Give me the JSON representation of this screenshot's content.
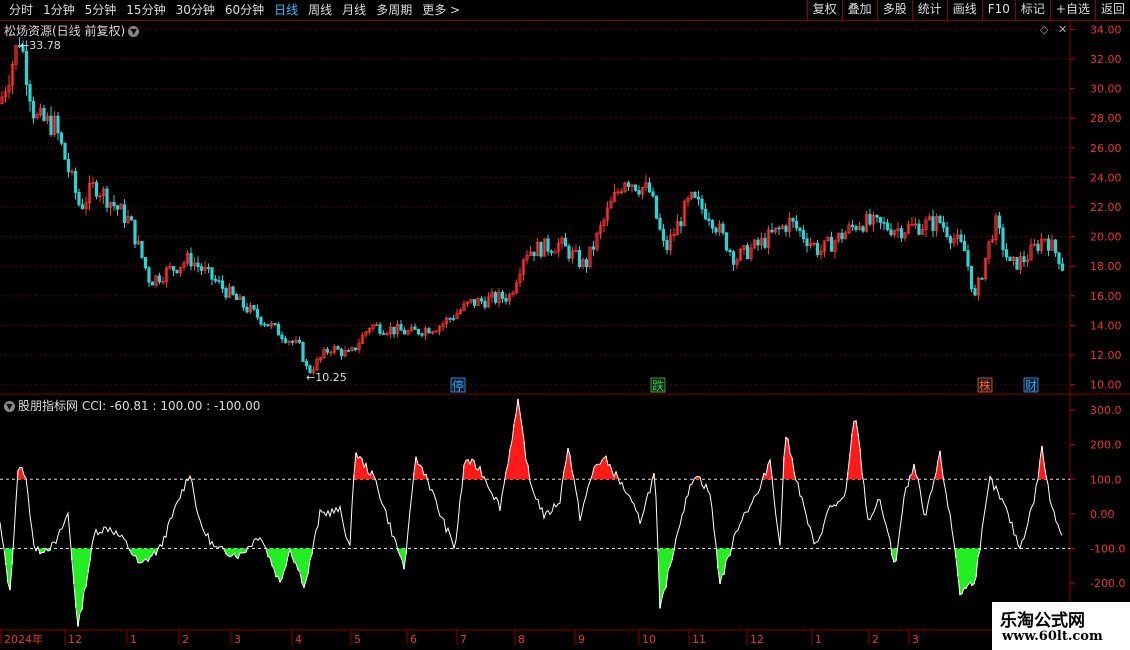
{
  "toolbar": {
    "periods": [
      "分时",
      "1分钟",
      "5分钟",
      "15分钟",
      "30分钟",
      "60分钟",
      "日线",
      "周线",
      "月线",
      "多周期",
      "更多 >"
    ],
    "active_period": "日线",
    "buttons": [
      "复权",
      "叠加",
      "多股",
      "统计",
      "画线",
      "F10",
      "标记",
      "+自选",
      "返回"
    ]
  },
  "main_chart": {
    "title": "松炀资源(日线 前复权)",
    "high_label": "33.78",
    "low_label": "10.25",
    "y_ticks": [
      "34.00",
      "32.00",
      "30.00",
      "28.00",
      "26.00",
      "24.00",
      "22.00",
      "20.00",
      "18.00",
      "16.00",
      "14.00",
      "12.00",
      "10.00"
    ],
    "markers": [
      {
        "text": "停",
        "color": "#2aa6ff"
      },
      {
        "text": "跌",
        "color": "#2ecc40"
      },
      {
        "text": "株",
        "color": "#ff5a2a"
      },
      {
        "text": "财",
        "color": "#2aa6ff"
      }
    ]
  },
  "indicator": {
    "title": "股朋指标网",
    "params": "CCI: -60.81 : 100.00 : -100.00",
    "y_ticks": [
      "300.0",
      "200.0",
      "100.0",
      "0.00",
      "-100.0",
      "-200.0"
    ]
  },
  "x_axis": {
    "labels": [
      "2024年",
      "12",
      "1",
      "2",
      "3",
      "4",
      "5",
      "6",
      "7",
      "8",
      "9",
      "10",
      "11",
      "12",
      "1",
      "2",
      "3"
    ]
  },
  "watermark": {
    "line1": "乐淘公式网",
    "line2": "www.60lt.com"
  },
  "chart_data": {
    "type": "candlestick+line",
    "price_range": [
      10,
      34.5
    ],
    "cci_range": [
      -300,
      330
    ],
    "high": 33.78,
    "low": 10.25
  }
}
